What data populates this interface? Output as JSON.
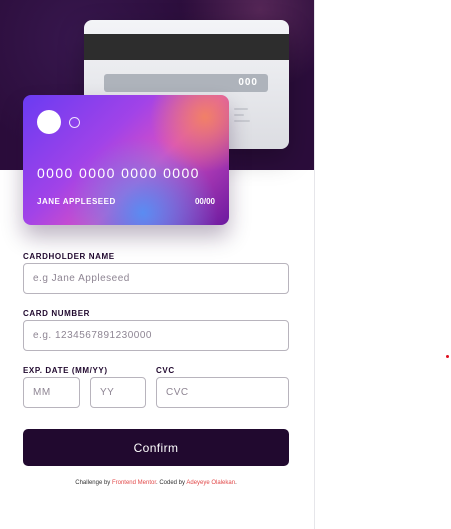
{
  "card_back": {
    "cvc": "000"
  },
  "card_front": {
    "number": "0000 0000 0000 0000",
    "name": "JANE APPLESEED",
    "expiry": "00/00"
  },
  "form": {
    "cardholder_label": "CARDHOLDER NAME",
    "cardholder_placeholder": "e.g Jane Appleseed",
    "card_number_label": "CARD NUMBER",
    "card_number_placeholder": "e.g. 1234567891230000",
    "exp_label": "EXP. DATE (MM/YY)",
    "month_placeholder": "MM",
    "year_placeholder": "YY",
    "cvc_label": "CVC",
    "cvc_placeholder": "CVC",
    "confirm_label": "Confirm"
  },
  "attribution": {
    "prefix": "Challenge by ",
    "link1": "Frontend Mentor",
    "middle": ". Coded by ",
    "link2": "Adeyeye Olalekan",
    "suffix": "."
  },
  "colors": {
    "hero_bg": "#2b0d3b",
    "button_bg": "#21092f",
    "link": "#e24a4a",
    "dot": "#e01020"
  }
}
